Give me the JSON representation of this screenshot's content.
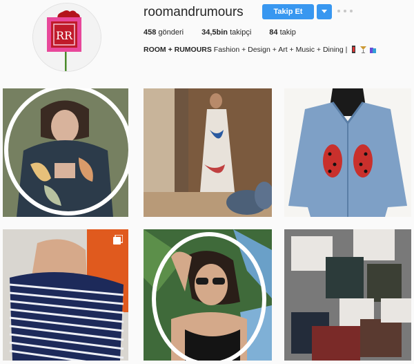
{
  "profile": {
    "username": "roomandrumours",
    "follow_label": "Takip Et",
    "stats": [
      {
        "count": "458",
        "label": "gönderi"
      },
      {
        "count": "34,5bin",
        "label": "takipçi"
      },
      {
        "count": "84",
        "label": "takip"
      }
    ],
    "bio": {
      "brand_strong": "ROOM + RUMOURS",
      "tagline": " Fashion + Design + Art + Music + Dining | "
    },
    "logo_letters": "RR"
  },
  "posts": [
    {
      "name": "post-floral-robe",
      "ring": true
    },
    {
      "name": "post-floral-dress",
      "ring": false
    },
    {
      "name": "post-denim-jacket-ladybug",
      "ring": false
    },
    {
      "name": "post-striped-ruffle-top",
      "ring": false,
      "gallery": true
    },
    {
      "name": "post-sunglasses-swimsuit",
      "ring": true
    },
    {
      "name": "post-gift-boxes-socks",
      "ring": false
    }
  ],
  "colors": {
    "accent": "#3897f0",
    "logo_red": "#b3141c",
    "logo_pink": "#e8489a"
  }
}
